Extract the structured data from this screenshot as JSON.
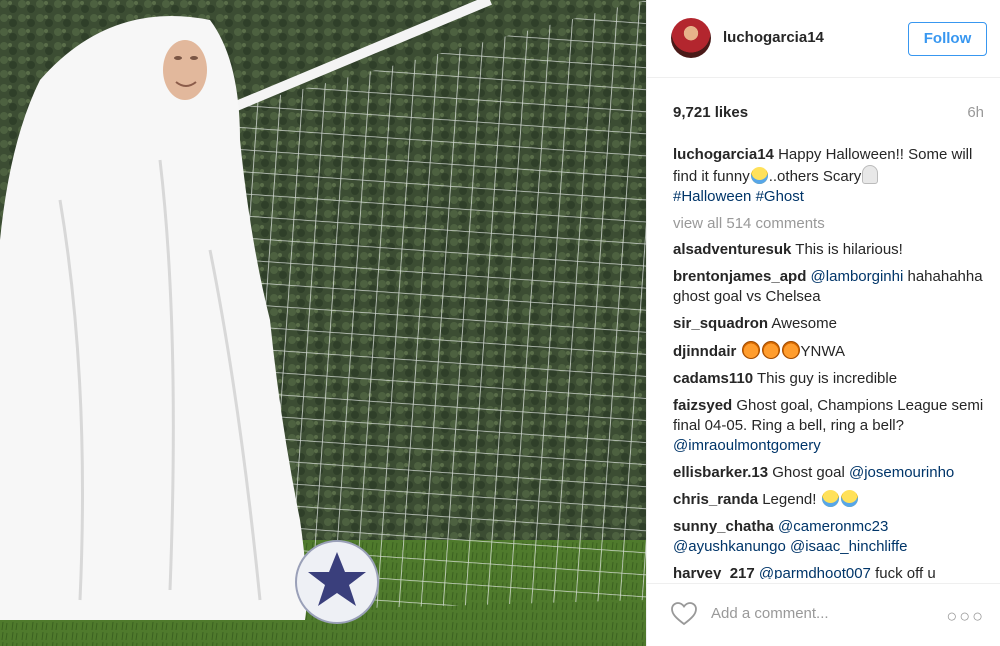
{
  "post": {
    "photo_alt": "Person in ghost costume beside soccer goal"
  },
  "header": {
    "username": "luchogarcia14",
    "follow_label": "Follow"
  },
  "stats": {
    "likes": "9,721 likes",
    "time": "6h"
  },
  "caption": {
    "username": "luchogarcia14",
    "text_1": "Happy Halloween!! Some will find it funny",
    "text_2": "..others Scary",
    "tag_1": "#Halloween",
    "tag_2": "#Ghost"
  },
  "view_all": "view all 514 comments",
  "comments": [
    {
      "user": "alsadventuresuk",
      "text": "This is hilarious!"
    },
    {
      "user": "brentonjames_apd",
      "mention": "@lamborginhi",
      "text": "hahahahha ghost goal vs Chelsea"
    },
    {
      "user": "sir_squadron",
      "text": "Awesome"
    },
    {
      "user": "djinndair",
      "text": "YNWA"
    },
    {
      "user": "cadams110",
      "text": "This guy is incredible"
    },
    {
      "user": "faizsyed",
      "text": "Ghost goal, Champions League semi final 04-05. Ring a bell, ring a bell?",
      "mention": "@imraoulmontgomery"
    },
    {
      "user": "ellisbarker.13",
      "text": "Ghost goal",
      "mention": "@josemourinho"
    },
    {
      "user": "chris_randa",
      "text": "Legend!"
    },
    {
      "user": "sunny_chatha",
      "mention": "@cameronmc23",
      "mention_2": "@ayushkanungo",
      "mention_3": "@isaac_hinchliffe"
    },
    {
      "user": "harvey_217",
      "mention": "@parmdhoot007",
      "text": "fuck off u"
    }
  ],
  "footer": {
    "add_comment_placeholder": "Add a comment...",
    "more_label": "○○○"
  },
  "colors": {
    "follow_blue": "#3897f0",
    "link_navy": "#003569",
    "muted_gray": "#999999"
  }
}
